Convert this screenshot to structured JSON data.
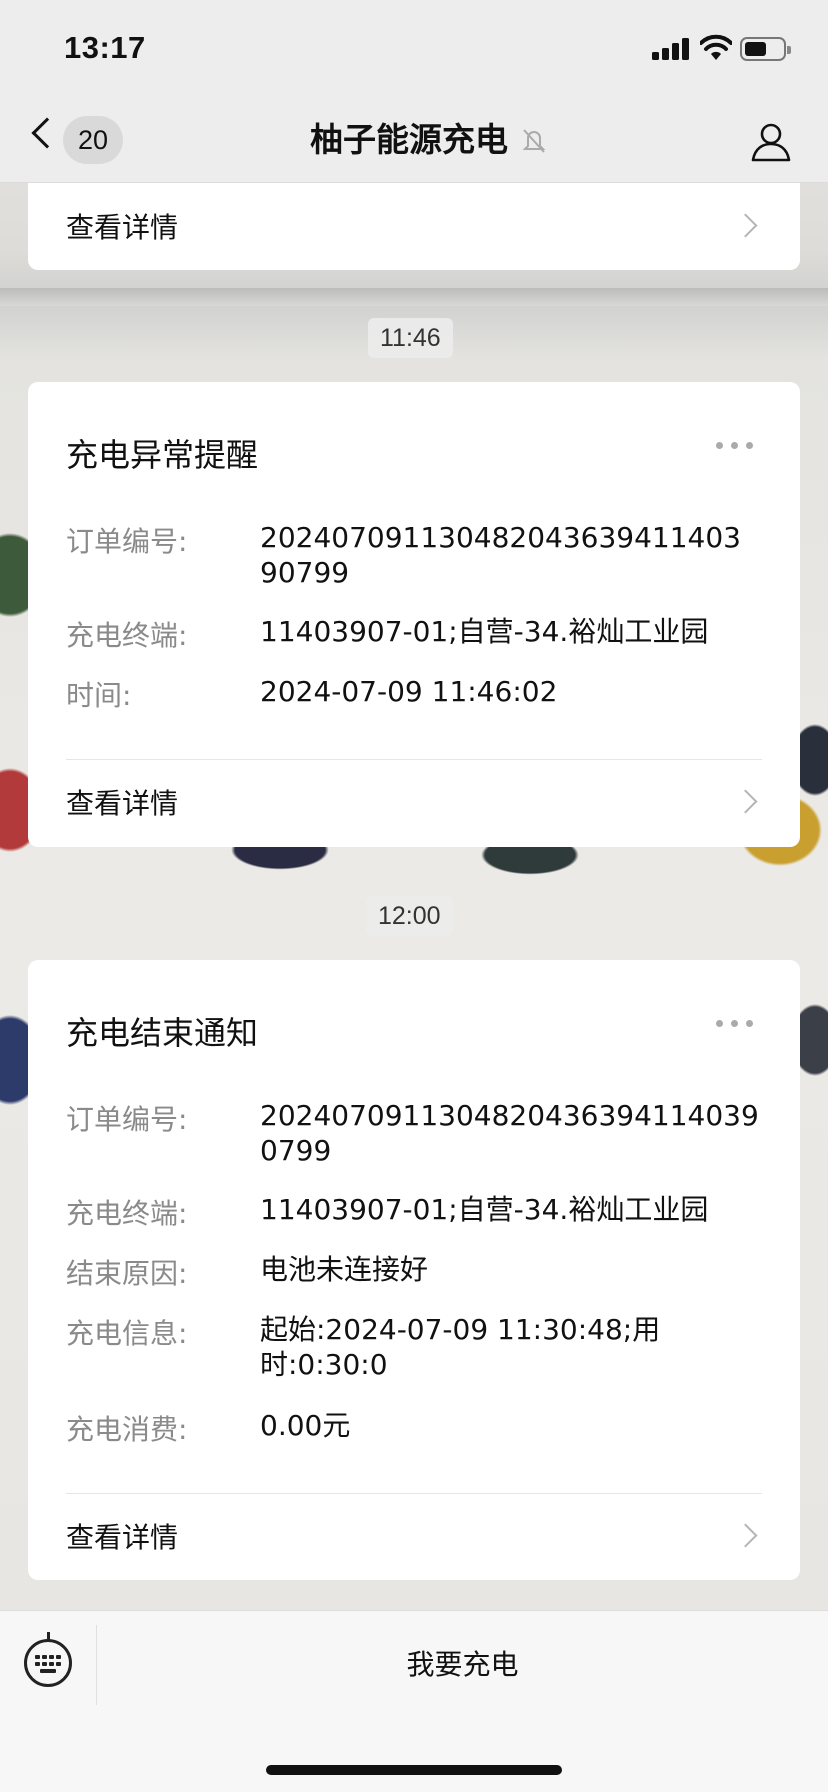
{
  "status_bar": {
    "time": "13:17"
  },
  "nav": {
    "back_count": "20",
    "title": "柚子能源充电"
  },
  "top_card": {
    "detail_label": "查看详情"
  },
  "messages": [
    {
      "timestamp": "11:46",
      "title": "充电异常提醒",
      "fields": [
        {
          "label": "订单编号:",
          "value": "202407091130482043639411403 90799"
        },
        {
          "label": "充电终端:",
          "value": "11403907-01;自营-34.裕灿工业园"
        },
        {
          "label": "时间:",
          "value": "2024-07-09 11:46:02"
        }
      ],
      "detail_label": "查看详情"
    },
    {
      "timestamp": "12:00",
      "title": "充电结束通知",
      "fields": [
        {
          "label": "订单编号:",
          "value": "2024070911304820436394114039 0799"
        },
        {
          "label": "充电终端:",
          "value": "11403907-01;自营-34.裕灿工业园"
        },
        {
          "label": "结束原因:",
          "value": "电池未连接好"
        },
        {
          "label": "充电信息:",
          "value": "起始:2024-07-09 11:30:48;用时:0:30:0"
        },
        {
          "label": "充电消费:",
          "value": "0.00元"
        }
      ],
      "detail_label": "查看详情"
    }
  ],
  "bottom_bar": {
    "menu_label": "我要充电"
  }
}
